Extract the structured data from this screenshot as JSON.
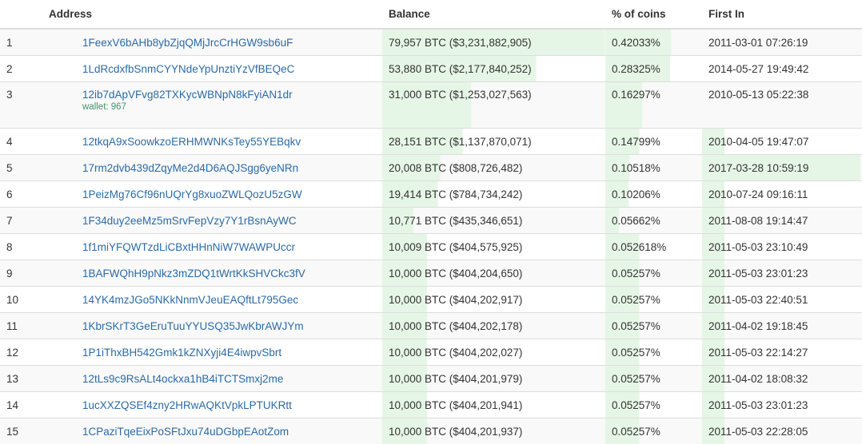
{
  "columns": {
    "address": "Address",
    "balance": "Balance",
    "percent": "% of coins",
    "first_in": "First In"
  },
  "bar_color": "#e6f6e6",
  "rows": [
    {
      "rank": "1",
      "address": "1FeexV6bAHb8ybZjqQMjJrcCrHGW9sb6uF",
      "wallet": "",
      "balance": "79,957 BTC ($3,231,882,905)",
      "percent": "0.42033%",
      "first_in": "2011-03-01 07:26:19",
      "balance_fill": 0.998,
      "percent_fill": 0.68,
      "first_fill": 0.0
    },
    {
      "rank": "2",
      "address": "1LdRcdxfbSnmCYYNdeYpUnztiYzVfBEQeC",
      "wallet": "",
      "balance": "53,880 BTC ($2,177,840,252)",
      "percent": "0.28325%",
      "first_in": "2014-05-27 19:49:42",
      "balance_fill": 0.69,
      "percent_fill": 0.67,
      "first_fill": 0.0
    },
    {
      "rank": "3",
      "address": "12ib7dApVFvg82TXKycWBNpN8kFyiAN1dr",
      "wallet": "wallet: 967",
      "balance": "31,000 BTC ($1,253,027,563)",
      "percent": "0.16297%",
      "first_in": "2010-05-13 05:22:38",
      "balance_fill": 0.4,
      "percent_fill": 0.38,
      "first_fill": 0.0
    },
    {
      "rank": "4",
      "address": "12tkqA9xSoowkzoERHMWNKsTey55YEBqkv",
      "wallet": "",
      "balance": "28,151 BTC ($1,137,870,071)",
      "percent": "0.14799%",
      "first_in": "2010-04-05 19:47:07",
      "balance_fill": 0.36,
      "percent_fill": 0.35,
      "first_fill": 0.14
    },
    {
      "rank": "5",
      "address": "17rm2dvb439dZqyMe2d4D6AQJSgg6yeNRn",
      "wallet": "",
      "balance": "20,008 BTC ($808,726,482)",
      "percent": "0.10518%",
      "first_in": "2017-03-28 10:59:19",
      "balance_fill": 0.26,
      "percent_fill": 0.25,
      "first_fill": 0.99
    },
    {
      "rank": "6",
      "address": "1PeizMg76Cf96nUQrYg8xuoZWLQozU5zGW",
      "wallet": "",
      "balance": "19,414 BTC ($784,734,242)",
      "percent": "0.10206%",
      "first_in": "2010-07-24 09:16:11",
      "balance_fill": 0.25,
      "percent_fill": 0.24,
      "first_fill": 0.14
    },
    {
      "rank": "7",
      "address": "1F34duy2eeMz5mSrvFepVzy7Y1rBsnAyWC",
      "wallet": "",
      "balance": "10,771 BTC ($435,346,651)",
      "percent": "0.05662%",
      "first_in": "2011-08-08 19:14:47",
      "balance_fill": 0.14,
      "percent_fill": 0.14,
      "first_fill": 0.14
    },
    {
      "rank": "8",
      "address": "1f1miYFQWTzdLiCBxtHHnNiW7WAWPUccr",
      "wallet": "",
      "balance": "10,009 BTC ($404,575,925)",
      "percent": "0.052618%",
      "first_in": "2011-05-03 23:10:49",
      "balance_fill": 0.2,
      "percent_fill": 0.35,
      "first_fill": 0.14
    },
    {
      "rank": "9",
      "address": "1BAFWQhH9pNkz3mZDQ1tWrtKkSHVCkc3fV",
      "wallet": "",
      "balance": "10,000 BTC ($404,204,650)",
      "percent": "0.05257%",
      "first_in": "2011-05-03 23:01:23",
      "balance_fill": 0.2,
      "percent_fill": 0.35,
      "first_fill": 0.14
    },
    {
      "rank": "10",
      "address": "14YK4mzJGo5NKkNnmVJeuEAQftLt795Gec",
      "wallet": "",
      "balance": "10,000 BTC ($404,202,917)",
      "percent": "0.05257%",
      "first_in": "2011-05-03 22:40:51",
      "balance_fill": 0.2,
      "percent_fill": 0.35,
      "first_fill": 0.14
    },
    {
      "rank": "11",
      "address": "1KbrSKrT3GeEruTuuYYUSQ35JwKbrAWJYm",
      "wallet": "",
      "balance": "10,000 BTC ($404,202,178)",
      "percent": "0.05257%",
      "first_in": "2011-04-02 19:18:45",
      "balance_fill": 0.2,
      "percent_fill": 0.35,
      "first_fill": 0.14
    },
    {
      "rank": "12",
      "address": "1P1iThxBH542Gmk1kZNXyji4E4iwpvSbrt",
      "wallet": "",
      "balance": "10,000 BTC ($404,202,027)",
      "percent": "0.05257%",
      "first_in": "2011-05-03 22:14:27",
      "balance_fill": 0.2,
      "percent_fill": 0.35,
      "first_fill": 0.14
    },
    {
      "rank": "13",
      "address": "12tLs9c9RsALt4ockxa1hB4iTCTSmxj2me",
      "wallet": "",
      "balance": "10,000 BTC ($404,201,979)",
      "percent": "0.05257%",
      "first_in": "2011-04-02 18:08:32",
      "balance_fill": 0.2,
      "percent_fill": 0.35,
      "first_fill": 0.14
    },
    {
      "rank": "14",
      "address": "1ucXXZQSEf4zny2HRwAQKtVpkLPTUKRtt",
      "wallet": "",
      "balance": "10,000 BTC ($404,201,941)",
      "percent": "0.05257%",
      "first_in": "2011-05-03 23:01:23",
      "balance_fill": 0.2,
      "percent_fill": 0.35,
      "first_fill": 0.14
    },
    {
      "rank": "15",
      "address": "1CPaziTqeEixPoSFtJxu74uDGbpEAotZom",
      "wallet": "",
      "balance": "10,000 BTC ($404,201,937)",
      "percent": "0.05257%",
      "first_in": "2011-05-03 22:28:05",
      "balance_fill": 0.2,
      "percent_fill": 0.35,
      "first_fill": 0.14
    }
  ]
}
